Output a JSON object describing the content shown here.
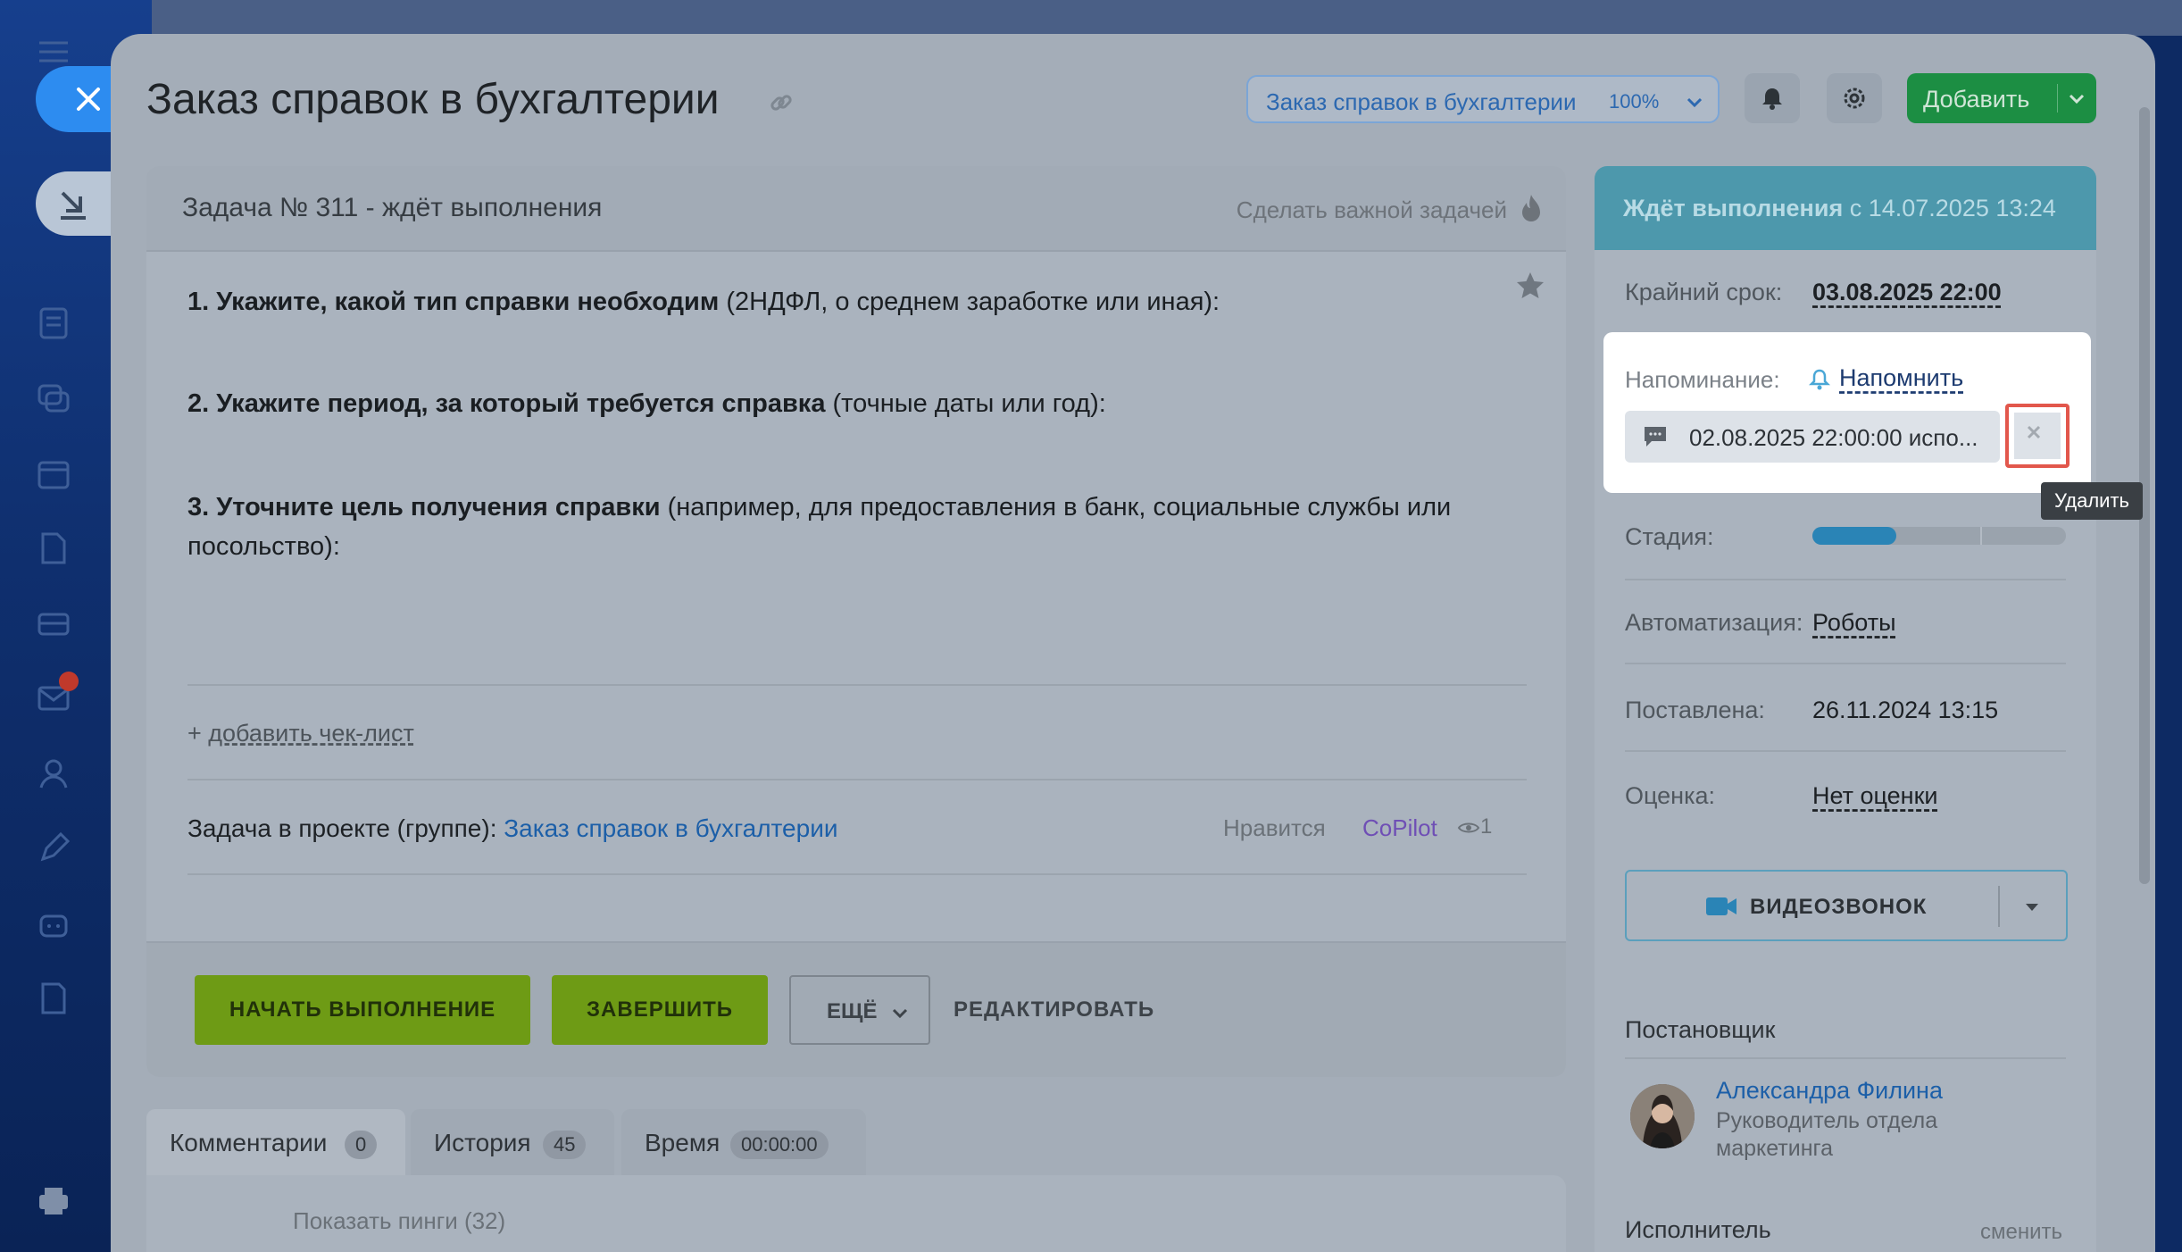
{
  "header": {
    "title": "Заказ справок в бухгалтерии",
    "project_select": {
      "label": "Заказ справок в бухгалтерии",
      "percent": "100%"
    },
    "add_button": "Добавить"
  },
  "task": {
    "heading": "Задача № 311 - ждёт выполнения",
    "make_important": "Сделать важной задачей",
    "description": [
      {
        "bold": "1. Укажите, какой тип справки необходим",
        "rest": " (2НДФЛ, о среднем заработке или иная):"
      },
      {
        "bold": "2. Укажите период, за который требуется справка",
        "rest": " (точные даты или год):"
      },
      {
        "bold": "3. Уточните цель получения справки",
        "rest": " (например, для предоставления в банк, социальные службы или посольство):"
      }
    ],
    "add_checklist_plus": "+ ",
    "add_checklist": "добавить чек-лист",
    "project_label": "Задача в проекте (группе):",
    "project_link": "Заказ справок в бухгалтерии",
    "likes": "Нравится",
    "copilot": "CoPilot",
    "views": "1"
  },
  "actions": {
    "start": "НАЧАТЬ ВЫПОЛНЕНИЕ",
    "finish": "ЗАВЕРШИТЬ",
    "more": "ЕЩЁ",
    "edit": "РЕДАКТИРОВАТЬ"
  },
  "tabs": [
    {
      "label": "Комментарии",
      "count": "0"
    },
    {
      "label": "История",
      "count": "45"
    },
    {
      "label": "Время",
      "count": "00:00:00"
    }
  ],
  "comments": {
    "show_pings": "Показать пинги (32)"
  },
  "sidebar": {
    "status_bold": "Ждёт выполнения",
    "status_rest": " с 14.07.2025 13:24",
    "deadline_label": "Крайний срок:",
    "deadline_value": "03.08.2025 22:00",
    "reminder_label": "Напоминание:",
    "reminder_action": "Напомнить",
    "reminder_item": "02.08.2025 22:00:00 испо...",
    "delete_tooltip": "Удалить",
    "stage_label": "Стадия:",
    "stage_progress": 0.33,
    "automation_label": "Автоматизация:",
    "automation_value": "Роботы",
    "created_label": "Поставлена:",
    "created_value": "26.11.2024 13:15",
    "rating_label": "Оценка:",
    "rating_value": "Нет оценки",
    "video_call": "ВИДЕОЗВОНОК",
    "creator_heading": "Постановщик",
    "creator_name": "Александра Филина",
    "creator_role": "Руководитель отдела маркетинга",
    "assignee_heading": "Исполнитель",
    "change_link": "сменить"
  },
  "colors": {
    "accent_green": "#6e9b15",
    "status_teal": "#4d98ac",
    "highlight_red": "#e2574c",
    "link_blue": "#1c5fa8"
  }
}
